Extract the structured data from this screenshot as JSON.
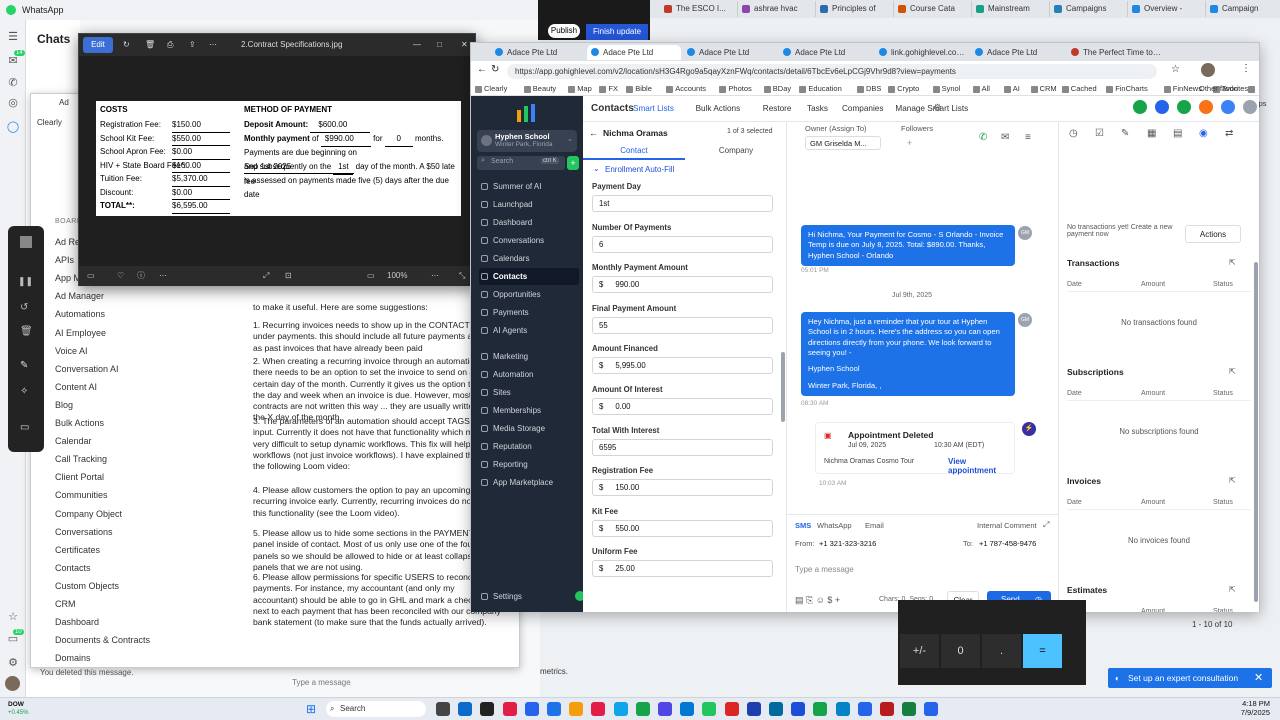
{
  "top_tabs": [
    {
      "label": "The ESCO I...",
      "color": "#c0392b"
    },
    {
      "label": "ashrae hvac",
      "color": "#8e44ad"
    },
    {
      "label": "Principles of",
      "color": "#2b6cb0"
    },
    {
      "label": "Course Cata",
      "color": "#d35400"
    },
    {
      "label": "Mainstream",
      "color": "#16a085"
    },
    {
      "label": "Campaigns",
      "color": "#2980b9"
    },
    {
      "label": "Overview -",
      "color": "#1e88e5"
    },
    {
      "label": "Campaign",
      "color": "#1e88e5"
    }
  ],
  "whatsapp": {
    "title": "WhatsApp",
    "chats_label": "Chats",
    "deleted_message": "You deleted this message.",
    "type_placeholder": "Type a message",
    "rail_badge": "14",
    "rail_badge2": "10"
  },
  "publish": {
    "publish_label": "Publish",
    "finish_label": "Finish update"
  },
  "photo_viewer": {
    "edit_label": "Edit",
    "filename": "2.Contract Specifications.jpg",
    "zoom": "100%",
    "doc": {
      "costs_title": "COSTS",
      "payment_title": "METHOD OF PAYMENT",
      "cost_rows": [
        {
          "label": "Registration Fee:",
          "value": "$150.00"
        },
        {
          "label": "School Kit Fee:",
          "value": "$550.00"
        },
        {
          "label": "School Apron Fee:",
          "value": "$0.00"
        },
        {
          "label": "HIV + State Board Fee*:",
          "value": "$160.00"
        },
        {
          "label": "Tuition Fee:",
          "value": "$5,370.00"
        },
        {
          "label": "Discount:",
          "value": "$0.00"
        },
        {
          "label": "TOTAL**:",
          "value": "$6,595.00"
        }
      ],
      "deposit_label": "Deposit Amount:",
      "deposit_value": "$600.00",
      "monthly_label": "Monthly payment",
      "monthly_of": "of",
      "monthly_value": "$990.00",
      "for_label": "for",
      "for_value": "0",
      "months_label": "months.",
      "due_label": "Payments are due beginning on",
      "due_value": "Sep 1st 2025",
      "and_sub": "and subsequently on the",
      "day_value": "1st",
      "day_rest": "day of the month. A $50 late fee",
      "late_line": "is assessed on payments made five (5) days after the due date"
    }
  },
  "behind_window": {
    "app_label": "Ad",
    "boards_label": "BOARDS",
    "clearly": "Clearly",
    "menu": [
      "Ad Rep",
      "APIs",
      "App M",
      "Ad Manager",
      "Automations",
      "AI Employee",
      "Voice AI",
      "Conversation AI",
      "Content AI",
      "Blog",
      "Bulk Actions",
      "Calendar",
      "Call Tracking",
      "Client Portal",
      "Communities",
      "Company Object",
      "Conversations",
      "Certificates",
      "Contacts",
      "Custom Objects",
      "CRM",
      "Dashboard",
      "Documents & Contracts",
      "Domains"
    ],
    "intro": "to make it useful.  Here are some suggestions:",
    "paras": [
      "1. Recurring invoices needs to show up in the CONTACTS view under payments.  this should include all future payments as well as past invoices that have already been paid",
      "2. When creating a recurring invoice through an automation, there needs to be an option to set the invoice to send on a certain day of the month.  Currently it gives us the option to set the day and week when an invoice is due. However, most contracts are not written this way ... they are usually written as the X day of the month.",
      "3. The parameters of an automation should accept TAGS as input.  Currently it does not have that functionality which makes it very difficult to setup dynamic workflows.  This fix will help all workflows (not just invoice workflows).  I have explained that in the following Loom video:",
      "4. Please allow customers the option to pay an upcoming recurring invoice early.  Currently, recurring invoices do not allow this functionality (see the Loom video).",
      "5. Please allow us to hide some sections in the PAYMENTS panel inside of contact.  Most of us only use one of the four panels so we should be allowed to hide or at least collapse the panels that we are not using.",
      "6. Please allow permissions for specific USERS to reconcile payments.  For instance, my accountant (and only my accountant) should be able to go in GHL and mark a checkbox next to each payment that has been reconciled with our company bank statement (to make sure that the funds actually arrived)."
    ]
  },
  "browser": {
    "tabs": [
      "Adace Pte Ltd",
      "Adace Pte Ltd",
      "Adace Pte Ltd",
      "Adace Pte Ltd",
      "link.gohighlevel.com/wi",
      "Adace Pte Ltd",
      "The Perfect Time to Lo..."
    ],
    "url": "https://app.gohighlevel.com/v2/location/sH3G4Rgo9a5qayXznFWq/contacts/detail/6TbcEv6eLpCGj9Vhr9d8?view=payments",
    "bookmarks": [
      "Clearly",
      "Beauty",
      "Map",
      "FX",
      "Bible",
      "Accounts",
      "Photos",
      "BDay",
      "Education",
      "DBS",
      "Crypto",
      "Synol",
      "All",
      "AI",
      "CRM",
      "Cached",
      "FinCharts",
      "FinNews",
      "Todo",
      "Maps"
    ],
    "other_favorites": "Other favorites"
  },
  "sidebar": {
    "location_name": "Hyphen School",
    "location_city": "Winter Park, Florida",
    "search_placeholder": "Search",
    "search_kbd": "ctrl K",
    "items": [
      "Summer of AI",
      "Launchpad",
      "Dashboard",
      "Conversations",
      "Calendars",
      "Contacts",
      "Opportunities",
      "Payments",
      "AI Agents",
      "Marketing",
      "Automation",
      "Sites",
      "Memberships",
      "Media Storage",
      "Reputation",
      "Reporting",
      "App Marketplace"
    ],
    "active_index": 5,
    "settings": "Settings"
  },
  "header": {
    "title": "Contacts",
    "nav": [
      "Smart Lists",
      "Bulk Actions",
      "Restore",
      "Tasks",
      "Companies",
      "Manage Smart Lists"
    ],
    "active_index": 0
  },
  "contact": {
    "name": "Nichma Oramas",
    "pager": "1 of 3 selected",
    "tab_contact": "Contact",
    "tab_company": "Company",
    "section": "Enrollment Auto-Fill",
    "fields": [
      {
        "label": "Payment Day",
        "value": "1st",
        "prefix": ""
      },
      {
        "label": "Number Of Payments",
        "value": "6",
        "prefix": ""
      },
      {
        "label": "Monthly Payment Amount",
        "value": "990.00",
        "prefix": "$"
      },
      {
        "label": "Final Payment Amount",
        "value": "55",
        "prefix": ""
      },
      {
        "label": "Amount Financed",
        "value": "5,995.00",
        "prefix": "$"
      },
      {
        "label": "Amount Of Interest",
        "value": "0.00",
        "prefix": "$"
      },
      {
        "label": "Total With Interest",
        "value": "6595",
        "prefix": ""
      },
      {
        "label": "Registration Fee",
        "value": "150.00",
        "prefix": "$"
      },
      {
        "label": "Kit Fee",
        "value": "550.00",
        "prefix": "$"
      },
      {
        "label": "Uniform Fee",
        "value": "25.00",
        "prefix": "$"
      }
    ]
  },
  "conversation": {
    "owner_label": "Owner (Assign To)",
    "owner_value": "Griselda M...",
    "owner_initials": "GM",
    "followers_label": "Followers",
    "msg1": "Hi Nichma, Your Payment for Cosmo - S Orlando - Invoice Temp is due on July 8, 2025. Total: $890.00. Thanks, Hyphen School - Orlando",
    "msg1_time": "05:01 PM",
    "date_sep": "Jul 9th, 2025",
    "msg2": "Hey Nichma, just a reminder that your tour at Hyphen School is in 2 hours. Here's the address so you can open directions directly from your phone. We look forward to seeing you! -",
    "msg2_sig": "Hyphen School",
    "msg2_addr": "Winter Park, Florida, ,",
    "msg2_time": "08:30 AM",
    "appt_title": "Appointment Deleted",
    "appt_date": "Jul 09, 2025",
    "appt_time": "10:30 AM (EDT)",
    "appt_name": "Nichma Oramas Cosmo Tour",
    "appt_link": "View appointment",
    "appt_ts": "10:03 AM",
    "channels": [
      "SMS",
      "WhatsApp",
      "Email"
    ],
    "internal": "Internal Comment",
    "from_label": "From:",
    "from_value": "+1 321-323-3216",
    "to_label": "To:",
    "to_value": "+1 787-458-9476",
    "placeholder": "Type a message",
    "chars": "Chars: 0, Segs: 0",
    "clear": "Clear",
    "send": "Send"
  },
  "right_panel": {
    "no_tx_note": "No transactions yet! Create a new payment now",
    "actions": "Actions",
    "sections": [
      {
        "title": "Transactions",
        "empty": "No transactions found"
      },
      {
        "title": "Subscriptions",
        "empty": "No subscriptions found"
      },
      {
        "title": "Invoices",
        "empty": "No invoices found"
      },
      {
        "title": "Estimates",
        "empty": ""
      }
    ],
    "cols": [
      "Date",
      "Amount",
      "Status"
    ]
  },
  "calculator": {
    "keys": [
      "+/-",
      "0",
      ".",
      "="
    ],
    "page": "1 - 10 of 10"
  },
  "expert": {
    "label": "Set up an expert consultation"
  },
  "metrics": "metrics.",
  "taskbar": {
    "weather_label": "DOW",
    "weather_value": "+0.45%",
    "search": "Search",
    "time": "4:18 PM",
    "date": "7/9/2025"
  },
  "colors": {
    "accent": "#1d72e8",
    "sidebar": "#1f2937",
    "send": "#1d6ae5"
  }
}
